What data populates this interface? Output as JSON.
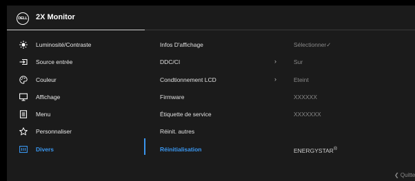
{
  "header": {
    "logo_text": "DELL",
    "title": "2X Monitor"
  },
  "menu": {
    "items": [
      {
        "label": "Luminosité/Contraste",
        "icon": "brightness-icon"
      },
      {
        "label": "Source entrée",
        "icon": "input-source-icon"
      },
      {
        "label": "Couleur",
        "icon": "palette-icon"
      },
      {
        "label": "Affichage",
        "icon": "display-icon"
      },
      {
        "label": "Menu",
        "icon": "menu-icon"
      },
      {
        "label": "Personnaliser",
        "icon": "star-icon"
      },
      {
        "label": "Divers",
        "icon": "others-icon",
        "active": true
      }
    ]
  },
  "content": {
    "rows": [
      {
        "label": "Infos D'affichage",
        "value": "Sélectionner",
        "check": "✓"
      },
      {
        "label": "DDC/CI",
        "value": "Sur",
        "chevron": "›"
      },
      {
        "label": "Condtionnement LCD",
        "value": "Eteint",
        "chevron": "›"
      },
      {
        "label": "Firmware",
        "value": "XXXXXX"
      },
      {
        "label": "Étiquette de service",
        "value": "XXXXXXX"
      },
      {
        "label": "Réinit. autres",
        "value": ""
      },
      {
        "label": "Réinitialisation",
        "value": "ENERGYSTAR",
        "sup": "®",
        "active": true
      }
    ]
  },
  "footer": {
    "quit_label": "❮ Quitte"
  },
  "colors": {
    "accent": "#3a97f0",
    "panel": "#1b1b1b",
    "background": "#000000"
  }
}
